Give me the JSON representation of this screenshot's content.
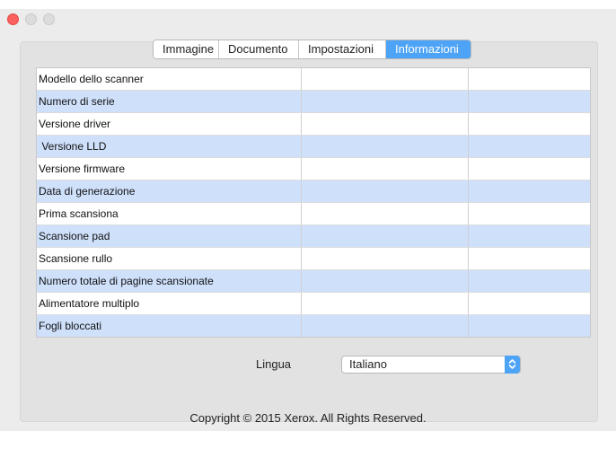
{
  "window": {
    "controls": [
      "close-icon",
      "minimize-icon",
      "maximize-icon"
    ],
    "accent": "#4da3f5"
  },
  "tabs": [
    {
      "label": "Immagine",
      "active": false
    },
    {
      "label": "Documento",
      "active": false
    },
    {
      "label": "Impostazioni",
      "active": false
    },
    {
      "label": "Informazioni",
      "active": true
    }
  ],
  "info_table": {
    "rows": [
      {
        "label": "Modello dello scanner",
        "value": "",
        "extra": ""
      },
      {
        "label": "Numero di serie",
        "value": "",
        "extra": ""
      },
      {
        "label": "Versione driver",
        "value": "",
        "extra": ""
      },
      {
        "label": " Versione LLD",
        "value": "",
        "extra": ""
      },
      {
        "label": "Versione firmware",
        "value": "",
        "extra": ""
      },
      {
        "label": "Data di generazione",
        "value": "",
        "extra": ""
      },
      {
        "label": "Prima scansiona",
        "value": "",
        "extra": ""
      },
      {
        "label": "Scansione pad",
        "value": "",
        "extra": ""
      },
      {
        "label": "Scansione rullo",
        "value": "",
        "extra": ""
      },
      {
        "label": "Numero totale di pagine scansionate",
        "value": "",
        "extra": ""
      },
      {
        "label": "Alimentatore multiplo",
        "value": "",
        "extra": ""
      },
      {
        "label": "Fogli bloccati",
        "value": "",
        "extra": ""
      }
    ]
  },
  "language": {
    "label": "Lingua",
    "selected": "Italiano"
  },
  "footer": {
    "copyright": "Copyright © 2015 Xerox. All Rights Reserved."
  }
}
